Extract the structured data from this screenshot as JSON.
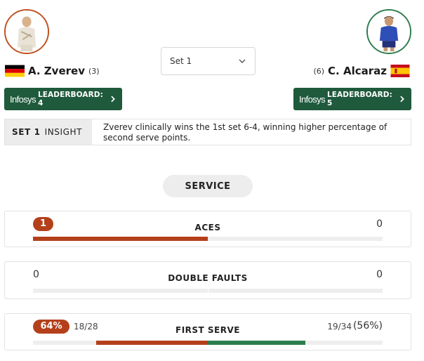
{
  "players": {
    "left": {
      "name": "A. Zverev",
      "seed": "(3)",
      "flag": "germany-flag",
      "leaderboard": {
        "brand": "Infosys",
        "text": "LEADERBOARD: 4"
      }
    },
    "right": {
      "name": "C. Alcaraz",
      "seed": "(6)",
      "flag": "spain-flag",
      "leaderboard": {
        "brand": "Infosys",
        "text": "LEADERBOARD: 5"
      }
    }
  },
  "set_selector": {
    "value": "Set 1"
  },
  "insight": {
    "label_bold": "SET 1",
    "label": "INSIGHT",
    "text": "Zverev clinically wins the 1st set 6-4, winning higher percentage of second serve points."
  },
  "section": {
    "title": "SERVICE"
  },
  "stats": [
    {
      "label": "ACES",
      "left": "1",
      "right": "0",
      "left_share": 0.5,
      "right_share": 0.0,
      "leader": "left"
    },
    {
      "label": "DOUBLE FAULTS",
      "left": "0",
      "right": "0",
      "left_share": 0.0,
      "right_share": 0.0,
      "leader": "none"
    },
    {
      "label": "FIRST SERVE",
      "left": "64%",
      "left_sub": "18/28",
      "right_sub": "19/34",
      "right": "(56%)",
      "left_share": 0.32,
      "right_share": 0.28,
      "leader": "left"
    }
  ],
  "colors": {
    "left_accent": "#b4401b",
    "right_accent": "#2e7d4f",
    "leaderboard_bg": "#1f5a3c"
  }
}
